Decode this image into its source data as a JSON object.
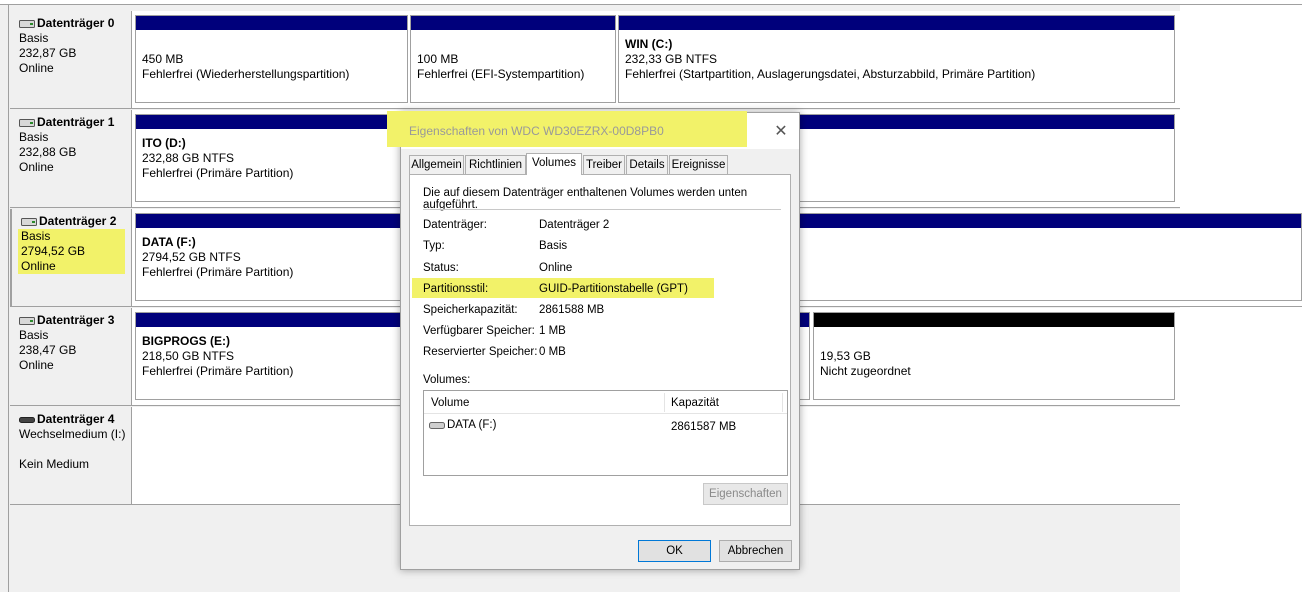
{
  "disks": [
    {
      "name": "Datenträger 0",
      "type": "Basis",
      "size": "232,87 GB",
      "status": "Online"
    },
    {
      "name": "Datenträger 1",
      "type": "Basis",
      "size": "232,88 GB",
      "status": "Online"
    },
    {
      "name": "Datenträger 2",
      "type": "Basis",
      "size": "2794,52 GB",
      "status": "Online"
    },
    {
      "name": "Datenträger 3",
      "type": "Basis",
      "size": "238,47 GB",
      "status": "Online"
    },
    {
      "name": "Datenträger 4",
      "type": "Wechselmedium (I:)",
      "size": "",
      "status": "Kein Medium"
    }
  ],
  "partitions": {
    "d0p1": {
      "size": "450 MB",
      "status": "Fehlerfrei (Wiederherstellungspartition)"
    },
    "d0p2": {
      "size": "100 MB",
      "status": "Fehlerfrei (EFI-Systempartition)"
    },
    "d0p3": {
      "name": "WIN  (C:)",
      "size": "232,33 GB NTFS",
      "status": "Fehlerfrei (Startpartition, Auslagerungsdatei, Absturzabbild, Primäre Partition)"
    },
    "d1p1": {
      "name": "ITO  (D:)",
      "size": "232,88 GB NTFS",
      "status": "Fehlerfrei (Primäre Partition)"
    },
    "d2p1": {
      "name": "DATA  (F:)",
      "size": "2794,52 GB NTFS",
      "status": "Fehlerfrei (Primäre Partition)"
    },
    "d3p1": {
      "name": "BIGPROGS  (E:)",
      "size": "218,50 GB NTFS",
      "status": "Fehlerfrei (Primäre Partition)"
    },
    "d3p2": {
      "size": "19,53 GB",
      "status": "Nicht zugeordnet"
    }
  },
  "dialog": {
    "title": "Eigenschaften von WDC WD30EZRX-00D8PB0",
    "close": "✕",
    "tabs": [
      "Allgemein",
      "Richtlinien",
      "Volumes",
      "Treiber",
      "Details",
      "Ereignisse"
    ],
    "active_tab": "Volumes",
    "description": "Die auf diesem Datenträger enthaltenen Volumes werden unten aufgeführt.",
    "props": [
      {
        "label": "Datenträger:",
        "value": "Datenträger 2"
      },
      {
        "label": "Typ:",
        "value": "Basis"
      },
      {
        "label": "Status:",
        "value": "Online"
      },
      {
        "label": "Partitionsstil:",
        "value": "GUID-Partitionstabelle (GPT)"
      },
      {
        "label": "Speicherkapazität:",
        "value": "2861588 MB"
      },
      {
        "label": "Verfügbarer Speicher:",
        "value": "1 MB"
      },
      {
        "label": "Reservierter Speicher:",
        "value": "0 MB"
      }
    ],
    "volumes_label": "Volumes:",
    "volumes_headers": [
      "Volume",
      "Kapazität"
    ],
    "volumes": [
      {
        "volume": "DATA (F:)",
        "capacity": "2861587 MB"
      }
    ],
    "properties_button": "Eigenschaften",
    "ok_button": "OK",
    "cancel_button": "Abbrechen"
  },
  "colors": {
    "partition_bar": "#00007b",
    "unallocated_bar": "#000000",
    "highlight": "#f2f269"
  }
}
